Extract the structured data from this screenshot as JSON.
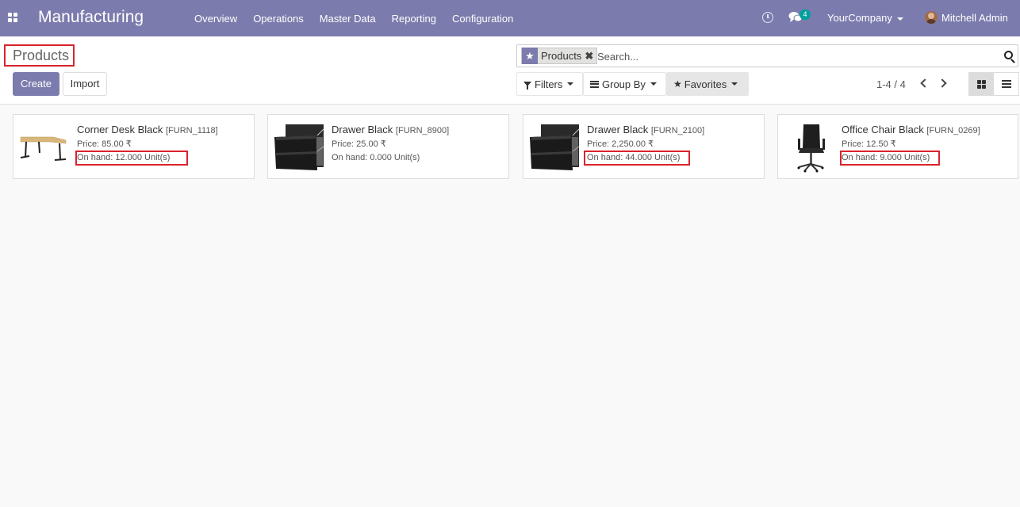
{
  "navbar": {
    "app_title": "Manufacturing",
    "menu": [
      "Overview",
      "Operations",
      "Master Data",
      "Reporting",
      "Configuration"
    ],
    "chat_count": "4",
    "company": "YourCompany",
    "user": "Mitchell Admin",
    "color": "#7c7bad"
  },
  "control_panel": {
    "title": "Products",
    "create_label": "Create",
    "import_label": "Import",
    "search": {
      "facet_label": "Products",
      "facet_icon": "star-icon",
      "placeholder": "Search..."
    },
    "filters_label": "Filters",
    "groupby_label": "Group By",
    "favorites_label": "Favorites",
    "pager": "1-4 / 4",
    "views": [
      "kanban",
      "list"
    ]
  },
  "products": [
    {
      "name": "Corner Desk Black",
      "code": "[FURN_1118]",
      "price": "Price: 85.00 ₹",
      "on_hand": "On hand: 12.000 Unit(s)",
      "image": "desk-image"
    },
    {
      "name": "Drawer Black",
      "code": "[FURN_8900]",
      "price": "Price: 25.00 ₹",
      "on_hand": "On hand: 0.000 Unit(s)",
      "image": "drawer-image"
    },
    {
      "name": "Drawer Black",
      "code": "[FURN_2100]",
      "price": "Price: 2,250.00 ₹",
      "on_hand": "On hand: 44.000 Unit(s)",
      "image": "drawer-image"
    },
    {
      "name": "Office Chair Black",
      "code": "[FURN_0269]",
      "price": "Price: 12.50 ₹",
      "on_hand": "On hand: 9.000 Unit(s)",
      "image": "chair-image"
    }
  ]
}
